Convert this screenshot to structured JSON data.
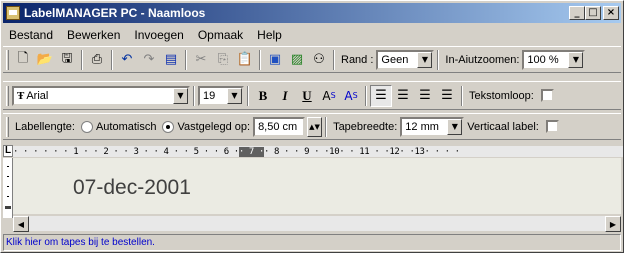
{
  "window": {
    "title": "LabelMANAGER PC - Naamloos"
  },
  "menu": [
    "Bestand",
    "Bewerken",
    "Invoegen",
    "Opmaak",
    "Help"
  ],
  "toolbar1": {
    "rand_label": "Rand :",
    "rand_value": "Geen",
    "zoom_label": "In-Aiutzoomen:",
    "zoom_value": "100 %"
  },
  "toolbar2": {
    "font_value": "Arial",
    "size_value": "19",
    "bold": "B",
    "italic": "I",
    "underline": "U",
    "superscript": "A",
    "superscript_mark": "S",
    "subscript": "A",
    "subscript_mark": "S",
    "wrap_label": "Tekstomloop:"
  },
  "toolbar3": {
    "length_label": "Labellengte:",
    "auto_label": "Automatisch",
    "fixed_label": "Vastgelegd op:",
    "length_value": "8,50 cm",
    "tape_label": "Tapebreedte:",
    "tape_value": "12 mm",
    "vertical_label": "Verticaal label:"
  },
  "ruler": {
    "corner": "L",
    "left": "· · · ·   · · 1 · · 2 · · 3 · · 4 · · 5 · · 6 ·",
    "dark": " · 7 · ",
    "right": "· 8 · · 9 · ·10· · 11 · ·12· ·13· · · ·"
  },
  "document": {
    "text": "07-dec-2001"
  },
  "status": {
    "text": "Klik hier om tapes bij te bestellen."
  }
}
